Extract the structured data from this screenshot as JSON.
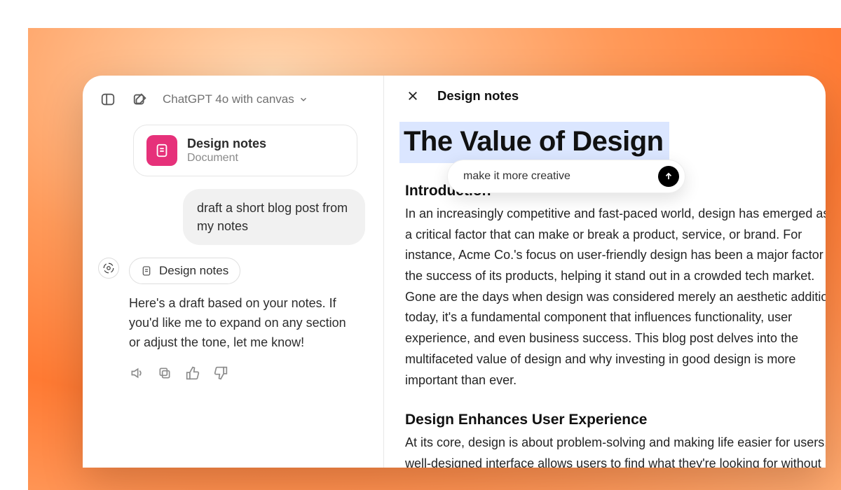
{
  "header": {
    "model_label": "ChatGPT 4o with canvas"
  },
  "chat": {
    "attachment": {
      "title": "Design notes",
      "subtitle": "Document"
    },
    "user_message": "draft a short blog post from my notes",
    "assistant": {
      "doc_chip": "Design notes",
      "text": "Here's a draft based on your notes. If you'd like me to expand on any section or adjust the tone, let me know!"
    }
  },
  "canvas": {
    "tab_title": "Design notes",
    "doc": {
      "h1": "The Value of Design",
      "sections": [
        {
          "heading": "Introduction",
          "body": "In an increasingly competitive and fast-paced world, design has emerged as a critical factor that can make or break a product, service, or brand. For instance, Acme Co.'s focus on user-friendly design has been a major factor in the success of its products, helping it stand out in a crowded tech market. Gone are the days when design was considered merely an aesthetic addition; today, it's a fundamental component that influences functionality, user experience, and even business success. This blog post delves into the multifaceted value of design and why investing in good design is more important than ever."
        },
        {
          "heading": "Design Enhances User Experience",
          "body": "At its core, design is about problem-solving and making life easier for users. A well-designed interface allows users to find what they're looking for without frustration, ensuring a smooth"
        }
      ]
    },
    "float_input": {
      "value": "make it more creative"
    }
  }
}
